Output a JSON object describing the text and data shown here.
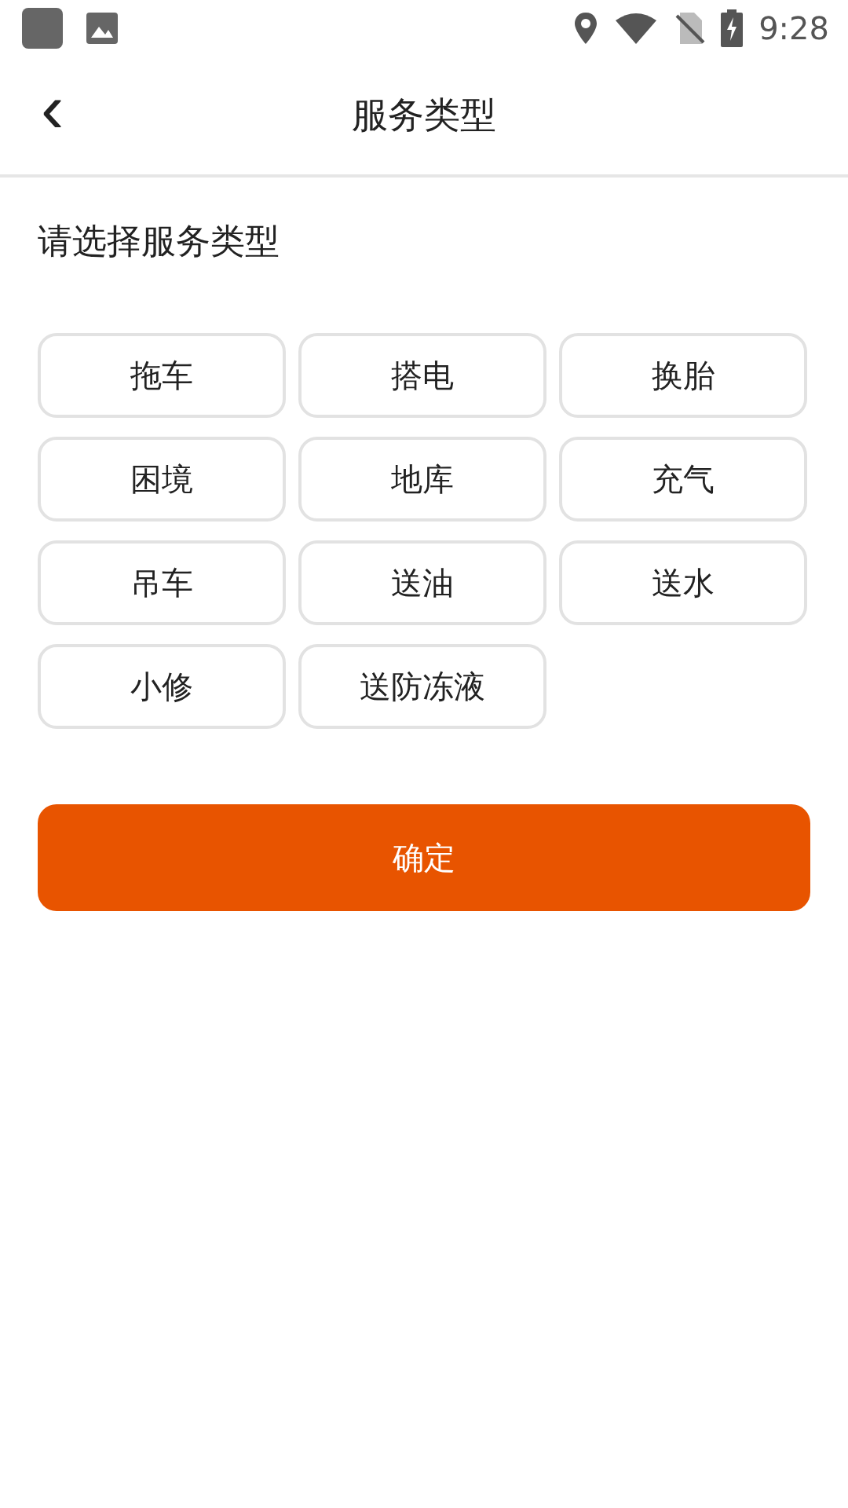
{
  "status_bar": {
    "time": "9:28"
  },
  "header": {
    "back": "‹",
    "title": "服务类型"
  },
  "prompt": "请选择服务类型",
  "options": [
    {
      "label": "拖车",
      "selected": false
    },
    {
      "label": "搭电",
      "selected": false
    },
    {
      "label": "换胎",
      "selected": false
    },
    {
      "label": "困境",
      "selected": false
    },
    {
      "label": "地库",
      "selected": false
    },
    {
      "label": "充气",
      "selected": false
    },
    {
      "label": "吊车",
      "selected": false
    },
    {
      "label": "送油",
      "selected": false
    },
    {
      "label": "送水",
      "selected": false
    },
    {
      "label": "小修",
      "selected": false
    },
    {
      "label": "送防冻液",
      "selected": false
    }
  ],
  "confirm_button": "确定"
}
